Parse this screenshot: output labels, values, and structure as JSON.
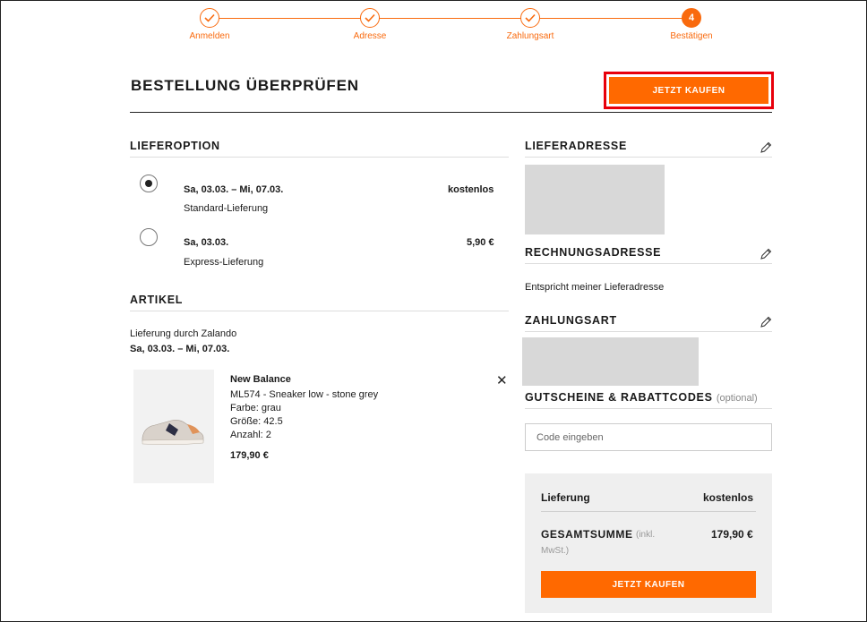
{
  "progress": {
    "steps": [
      {
        "label": "Anmelden"
      },
      {
        "label": "Adresse"
      },
      {
        "label": "Zahlungsart"
      },
      {
        "label": "Bestätigen",
        "number": "4"
      }
    ]
  },
  "header": {
    "title": "BESTELLUNG ÜBERPRÜFEN",
    "buy_label": "JETZT KAUFEN"
  },
  "delivery": {
    "heading": "LIEFEROPTION",
    "options": [
      {
        "dates": "Sa, 03.03. – Mi, 07.03.",
        "name": "Standard-Lieferung",
        "price": "kostenlos",
        "selected": true
      },
      {
        "dates": "Sa, 03.03.",
        "name": "Express-Lieferung",
        "price": "5,90 €",
        "selected": false
      }
    ]
  },
  "articles": {
    "heading": "ARTIKEL",
    "shipped_by": "Lieferung durch Zalando",
    "date_range": "Sa, 03.03. – Mi, 07.03.",
    "item": {
      "brand": "New Balance",
      "name": "ML574 - Sneaker low - stone grey",
      "color": "Farbe: grau",
      "size": "Größe: 42.5",
      "quantity": "Anzahl: 2",
      "price": "179,90 €"
    }
  },
  "shipping_address": {
    "heading": "LIEFERADRESSE"
  },
  "billing_address": {
    "heading": "RECHNUNGSADRESSE",
    "text": "Entspricht meiner Lieferadresse"
  },
  "payment": {
    "heading": "ZAHLUNGSART"
  },
  "voucher": {
    "heading": "GUTSCHEINE & RABATTCODES",
    "optional": "(optional)",
    "placeholder": "Code eingeben"
  },
  "summary": {
    "delivery_label": "Lieferung",
    "delivery_value": "kostenlos",
    "total_label": "GESAMTSUMME",
    "total_note_1": "(inkl.",
    "total_note_2": "MwSt.)",
    "total_value": "179,90 €",
    "buy_label": "JETZT KAUFEN"
  },
  "colors": {
    "accent": "#ff6900",
    "highlight_outline": "#e8000b"
  }
}
